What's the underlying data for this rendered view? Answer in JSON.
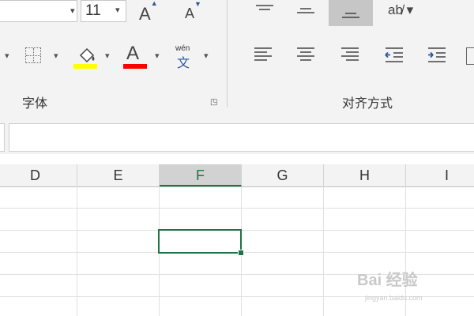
{
  "ribbon": {
    "font_group": {
      "font_size_value": "11",
      "group_label": "字体",
      "phonetic_top": "wén",
      "phonetic_char": "文"
    },
    "alignment_group": {
      "group_label": "对齐方式"
    },
    "colors": {
      "fill_color": "#ffff00",
      "font_color": "#ff0000"
    }
  },
  "sheet": {
    "columns": [
      "D",
      "E",
      "F",
      "G",
      "H",
      "I"
    ],
    "active_column": "F"
  },
  "watermark": {
    "title": "Bai 经验",
    "subtitle": "jingyan.baidu.com"
  }
}
